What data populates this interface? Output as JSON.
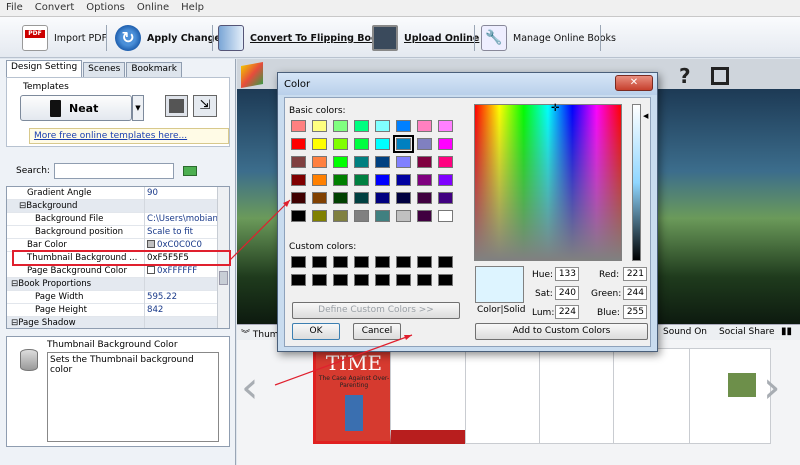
{
  "menu": [
    "File",
    "Convert",
    "Options",
    "Online",
    "Help"
  ],
  "toolbar": {
    "import_pdf": "Import PDF",
    "apply_change": "Apply Change",
    "convert": "Convert To Flipping Book",
    "upload": "Upload Online",
    "manage": "Manage Online Books"
  },
  "left": {
    "tabs": [
      "Design Setting",
      "Scenes",
      "Bookmark"
    ],
    "templates_label": "Templates",
    "template_name": "Neat",
    "more_templates": "More free online templates here...",
    "search_label": "Search:",
    "search_value": "",
    "properties": [
      {
        "k": "Gradient Angle",
        "v": "90",
        "indent": 2
      },
      {
        "k": "Background",
        "v": "",
        "indent": 1,
        "group": true
      },
      {
        "k": "Background File",
        "v": "C:\\Users\\mobian...",
        "indent": 3
      },
      {
        "k": "Background position",
        "v": "Scale to fit",
        "indent": 3
      },
      {
        "k": "Bar Color",
        "v": "0xC0C0C0",
        "indent": 2,
        "swatch": "#C0C0C0"
      },
      {
        "k": "Thumbnail Background ...",
        "v": "0xF5F5F5",
        "indent": 2,
        "selected": true
      },
      {
        "k": "Page Background Color",
        "v": "0xFFFFFF",
        "indent": 2,
        "swatch": "#FFFFFF"
      },
      {
        "k": "Book Proportions",
        "v": "",
        "indent": 0,
        "group": true
      },
      {
        "k": "Page Width",
        "v": "595.22",
        "indent": 3
      },
      {
        "k": "Page Height",
        "v": "842",
        "indent": 3
      },
      {
        "k": "Page Shadow",
        "v": "",
        "indent": 0,
        "group": true
      }
    ],
    "desc_title": "Thumbnail Background Color",
    "desc_text": "Sets the Thumbnail background color"
  },
  "viewer": {
    "bar_left": "Thum",
    "sound": "Sound On",
    "social": "Social Share",
    "thumb1_title": "TIME",
    "thumb1_sub": "The Case Against Over-Parenting"
  },
  "dialog": {
    "title": "Color",
    "basic_colors": "Basic colors:",
    "custom_colors": "Custom colors:",
    "define_custom": "Define Custom Colors >>",
    "ok": "OK",
    "cancel": "Cancel",
    "add_custom": "Add to Custom Colors",
    "color_solid": "Color|Solid",
    "hue_label": "Hue:",
    "hue": "133",
    "sat_label": "Sat:",
    "sat": "240",
    "lum_label": "Lum:",
    "lum": "224",
    "red_label": "Red:",
    "red": "221",
    "green_label": "Green:",
    "green": "244",
    "blue_label": "Blue:",
    "blue": "255",
    "preview_color": "#DDF4FF",
    "basic_palette": [
      [
        "#FF8080",
        "#FFFF80",
        "#80FF80",
        "#00FF80",
        "#80FFFF",
        "#0080FF",
        "#FF80C0",
        "#FF80FF"
      ],
      [
        "#FF0000",
        "#FFFF00",
        "#80FF00",
        "#00FF40",
        "#00FFFF",
        "#0080C0",
        "#8080C0",
        "#FF00FF"
      ],
      [
        "#804040",
        "#FF8040",
        "#00FF00",
        "#008080",
        "#004080",
        "#8080FF",
        "#800040",
        "#FF0080"
      ],
      [
        "#800000",
        "#FF8000",
        "#008000",
        "#008040",
        "#0000FF",
        "#0000A0",
        "#800080",
        "#8000FF"
      ],
      [
        "#400000",
        "#804000",
        "#004000",
        "#004040",
        "#000080",
        "#000040",
        "#400040",
        "#400080"
      ],
      [
        "#000000",
        "#808000",
        "#808040",
        "#808080",
        "#408080",
        "#C0C0C0",
        "#400040",
        "#FFFFFF"
      ]
    ],
    "selected_swatch": "#0080C0"
  }
}
